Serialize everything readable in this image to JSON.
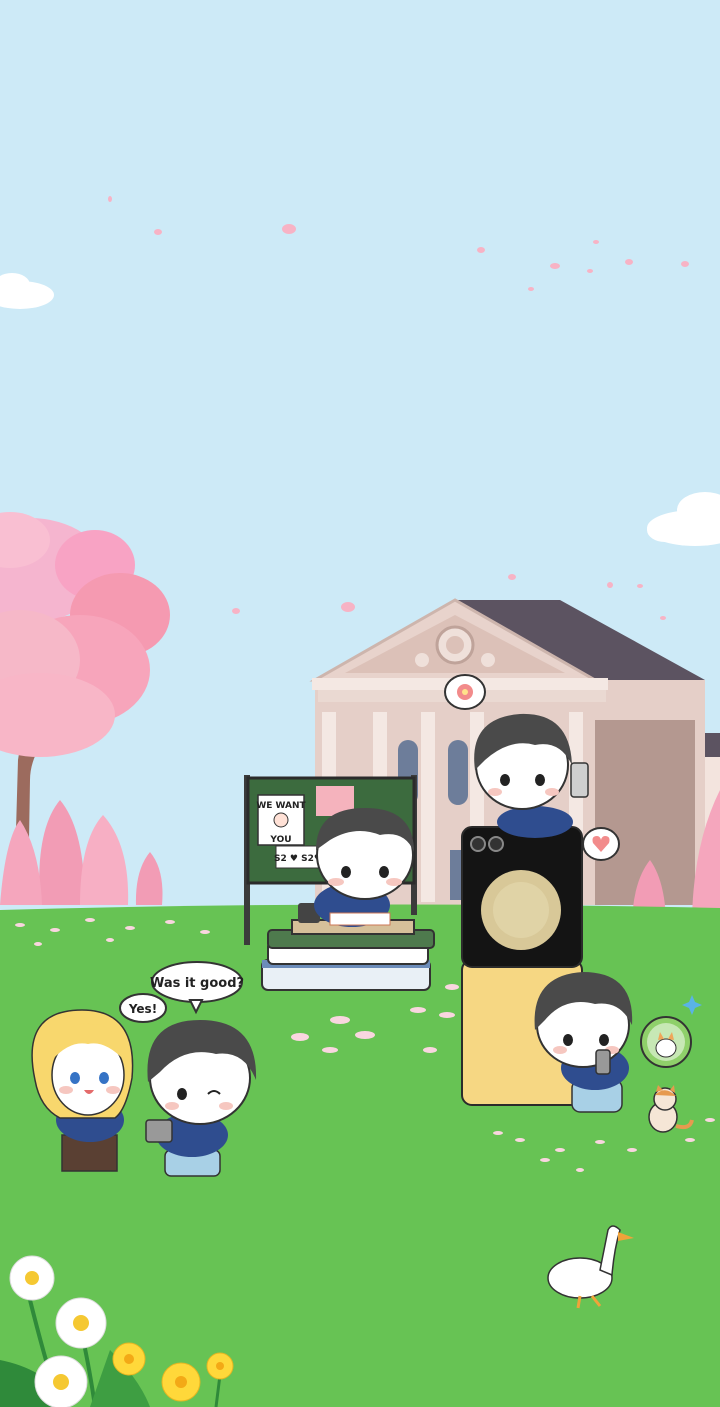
{
  "scene": {
    "colors": {
      "sky": "#cdeaf7",
      "grass": "#67c354",
      "blossom": "#f7a9c0",
      "building": "#e5cfc8",
      "roof": "#5c5361",
      "board": "#3c6b3e",
      "phone_bottom": "#f6d783",
      "phone_top": "#141414"
    },
    "bulletin_board": {
      "poster_line1": "WE WANT",
      "poster_line2": "YOU",
      "note": "S2 ♥ S2♥"
    },
    "speech": {
      "question": "Was it good?",
      "answer": "Yes!"
    },
    "icons": [
      "cloud-icon",
      "heart-icon",
      "flower-icon",
      "cat-icon",
      "sparkle-icon"
    ]
  }
}
